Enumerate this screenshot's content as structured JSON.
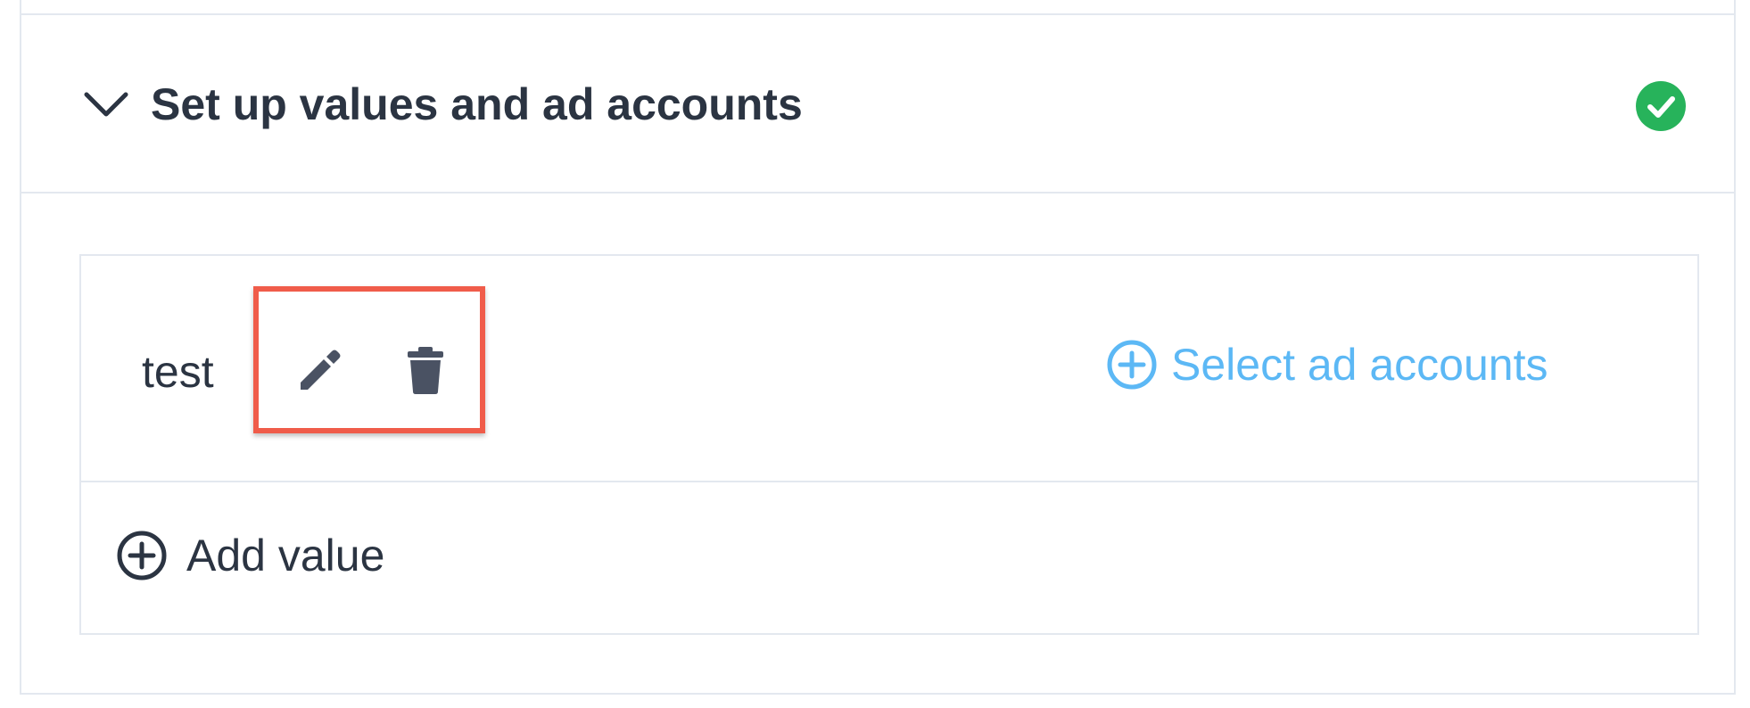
{
  "section": {
    "title": "Set up values and ad accounts",
    "status": "complete",
    "status_color": "#27b35b",
    "expanded": true
  },
  "values": [
    {
      "name": "test",
      "actions": [
        "edit-icon",
        "delete-icon"
      ],
      "select_accounts_label": "Select ad accounts"
    }
  ],
  "add_value_label": "Add value",
  "colors": {
    "text": "#2b3442",
    "link": "#5cb8f5",
    "highlight": "#f05c4a",
    "border": "#e3e8ef",
    "icon": "#4a5263"
  }
}
